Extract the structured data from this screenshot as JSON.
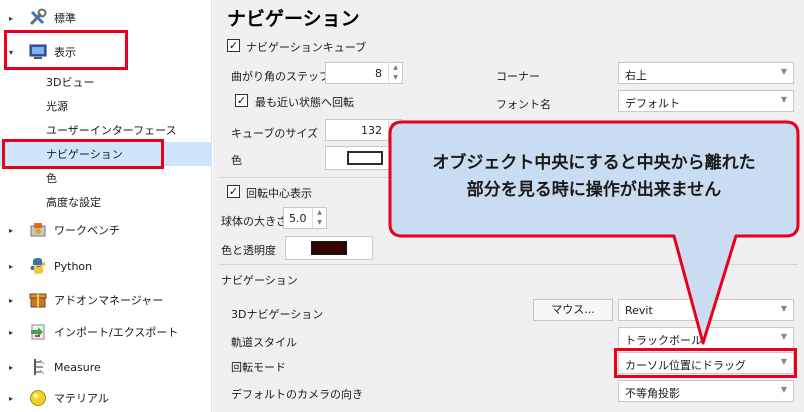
{
  "sidebar": {
    "items": [
      {
        "label": "標準",
        "arrow": "▸",
        "icon": "tools-icon"
      },
      {
        "label": "表示",
        "arrow": "▾",
        "icon": "monitor-icon"
      },
      {
        "label": "3Dビュー"
      },
      {
        "label": "光源"
      },
      {
        "label": "ユーザーインターフェース"
      },
      {
        "label": "ナビゲーション"
      },
      {
        "label": "色"
      },
      {
        "label": "高度な設定"
      },
      {
        "label": "ワークベンチ",
        "arrow": "▸",
        "icon": "workbench-icon"
      },
      {
        "label": "Python",
        "arrow": "▸",
        "icon": "python-icon"
      },
      {
        "label": "アドオンマネージャー",
        "arrow": "▸",
        "icon": "addon-manager-icon"
      },
      {
        "label": "インポート/エクスポート",
        "arrow": "▸",
        "icon": "import-export-icon"
      },
      {
        "label": "Measure",
        "arrow": "▸",
        "icon": "measure-icon"
      },
      {
        "label": "マテリアル",
        "arrow": "▸",
        "icon": "material-icon"
      }
    ]
  },
  "main": {
    "title": "ナビゲーション",
    "navcube": {
      "check": "✓",
      "label": "ナビゲーションキューブ",
      "steps_label": "曲がり角のステップ数",
      "steps_value": "8",
      "nearest_label": "最も近い状態へ回転",
      "size_label": "キューブのサイズ",
      "size_value": "132",
      "color_label": "色",
      "corner_label": "コーナー",
      "corner_value": "右上",
      "font_label": "フォント名",
      "font_value": "デフォルト"
    },
    "rotation_center": {
      "check": "✓",
      "label": "回転中心表示",
      "sphere_label": "球体の大きさ",
      "sphere_value": "5.0",
      "color_label": "色と透明度"
    },
    "navigation": {
      "section_label": "ナビゲーション",
      "nav3d_label": "3Dナビゲーション",
      "mouse_button": "マウス...",
      "nav3d_value": "Revit",
      "orbit_label": "軌道スタイル",
      "orbit_value": "トラックボール",
      "rotation_mode_label": "回転モード",
      "rotation_mode_value": "カーソル位置にドラッグ",
      "camera_label": "デフォルトのカメラの向き",
      "camera_value": "不等角投影"
    }
  },
  "callout": {
    "line1": "オブジェクト中央にすると中央から離れた",
    "line2": "部分を見る時に操作が出来ません"
  },
  "colors": {
    "selection": "#cfe5fb",
    "highlight": "#e8001c",
    "callout_fill": "#c9dcf1",
    "cube_swatch": "#5f5f5f",
    "rotation_swatch": "#3a0000"
  }
}
